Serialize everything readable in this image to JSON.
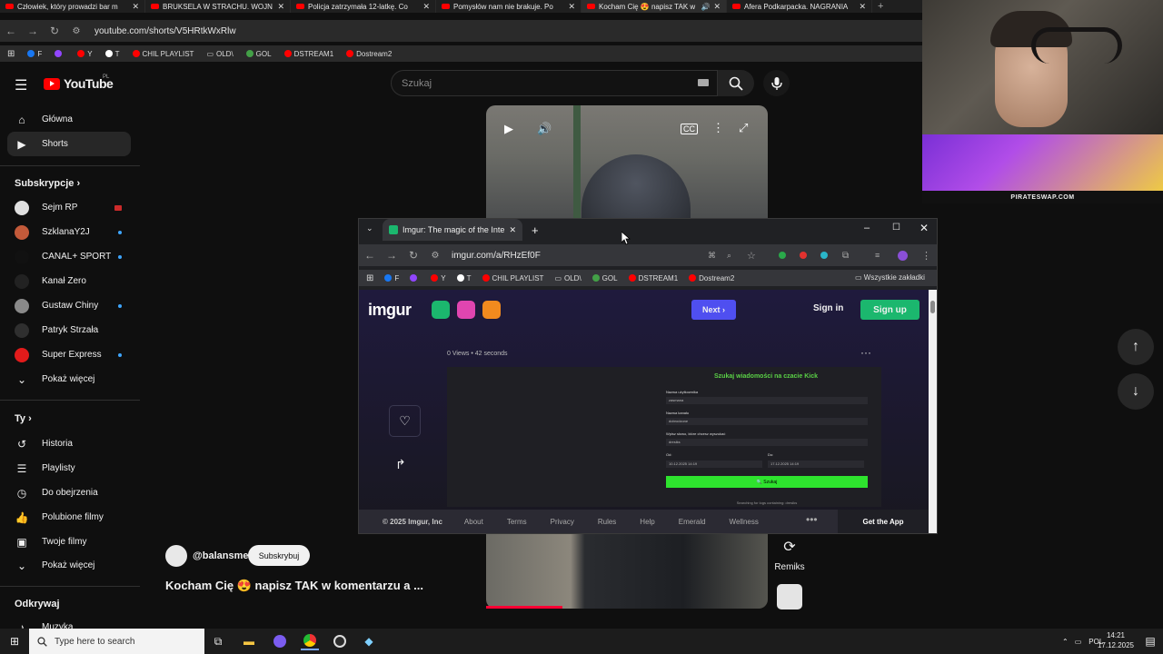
{
  "outer_tabs": [
    {
      "label": "Człowiek, który prowadzi bar m",
      "active": false,
      "audio": false
    },
    {
      "label": "BRUKSELA W STRACHU. WOJN",
      "active": false,
      "audio": false
    },
    {
      "label": "Policja zatrzymała 12-latkę. Co",
      "active": false,
      "audio": false
    },
    {
      "label": "Pomysłów nam nie brakuje. Po",
      "active": false,
      "audio": false
    },
    {
      "label": "Kocham Cię 😍 napisz TAK w",
      "active": true,
      "audio": true
    },
    {
      "label": "Afera Podkarpacka. NAGRANIA",
      "active": false,
      "audio": false
    }
  ],
  "outer_url": "youtube.com/shorts/V5HRtkWxRlw",
  "bookmarks": [
    {
      "label": "F",
      "color": "#1877f2"
    },
    {
      "label": "",
      "color": "#9146ff"
    },
    {
      "label": "Y",
      "color": "#ff0000"
    },
    {
      "label": "T",
      "color": "#ffffff"
    },
    {
      "label": "CHIL PLAYLIST",
      "color": "#ff0000"
    },
    {
      "label": "OLD\\",
      "color": "folder"
    },
    {
      "label": "GOL",
      "color": "#43a047"
    },
    {
      "label": "DSTREAM1",
      "color": "#ff0000"
    },
    {
      "label": "Dostream2",
      "color": "#ff0000"
    }
  ],
  "yt": {
    "logo": "YouTube",
    "region": "PL",
    "search_placeholder": "Szukaj"
  },
  "sidebar": {
    "main": [
      {
        "label": "Główna",
        "icon": "home-icon",
        "selected": false
      },
      {
        "label": "Shorts",
        "icon": "shorts-icon",
        "selected": true
      }
    ],
    "subs_title": "Subskrypcje",
    "subs": [
      {
        "label": "Sejm RP",
        "color": "#e0e0e0",
        "live": true
      },
      {
        "label": "SzklanaY2J",
        "color": "#c35a3a",
        "new": true
      },
      {
        "label": "CANAL+ SPORT",
        "color": "#111111",
        "new": true
      },
      {
        "label": "Kanał Zero",
        "color": "#222222",
        "new": false
      },
      {
        "label": "Gustaw Chiny",
        "color": "#8a8a8a",
        "new": true
      },
      {
        "label": "Patryk Strzała",
        "color": "#2f2f2f",
        "new": false
      },
      {
        "label": "Super Express",
        "color": "#e21b1b",
        "new": true
      }
    ],
    "show_more": "Pokaż więcej",
    "you_title": "Ty",
    "you": [
      {
        "label": "Historia",
        "icon": "history-icon"
      },
      {
        "label": "Playlisty",
        "icon": "playlist-icon"
      },
      {
        "label": "Do obejrzenia",
        "icon": "watch-later-icon"
      },
      {
        "label": "Polubione filmy",
        "icon": "like-icon"
      },
      {
        "label": "Twoje filmy",
        "icon": "your-videos-icon"
      }
    ],
    "show_more2": "Pokaż więcej",
    "explore_title": "Odkrywaj",
    "explore": [
      {
        "label": "Muzyka",
        "icon": "music-icon"
      }
    ]
  },
  "short": {
    "channel": "@balansme",
    "subscribe": "Subskrybuj",
    "title": "Kocham Cię 😍 napisz TAK w komentarzu a ...",
    "remix": "Remiks",
    "progress": 0.27
  },
  "stream_banner": "PIRATESWAP.COM",
  "imgur_window": {
    "tab_title": "Imgur: The magic of the Interne",
    "url": "imgur.com/a/RHzEf0F",
    "bookmarks_all": "Wszystkie zakładki",
    "next": "Next",
    "sign_in": "Sign in",
    "sign_up": "Sign up",
    "views": "0 Views • 42 seconds",
    "post": {
      "title": "Szukaj wiadomości na czacie Kick",
      "fields": [
        {
          "label": "Nazwa użytkownika",
          "value": "zasmana"
        },
        {
          "label": "Nazwa kanału",
          "value": "dobrodzone"
        },
        {
          "label": "Wpisz słowo, które chcesz wyszukać",
          "value": "dresiks"
        }
      ],
      "from_label": "Od:",
      "from_value": "10.12.2025 14:19",
      "to_label": "Do:",
      "to_value": "17.12.2025 14:19",
      "button": "Szukaj",
      "footer": "Searching for logs containing: dresiks"
    },
    "footer": [
      "© 2025 Imgur, Inc",
      "About",
      "Terms",
      "Privacy",
      "Rules",
      "Help",
      "Emerald",
      "Wellness"
    ],
    "get_app": "Get the App"
  },
  "taskbar": {
    "search_placeholder": "Type here to search",
    "lang": "POL",
    "time": "14:21",
    "date": "17.12.2025"
  }
}
